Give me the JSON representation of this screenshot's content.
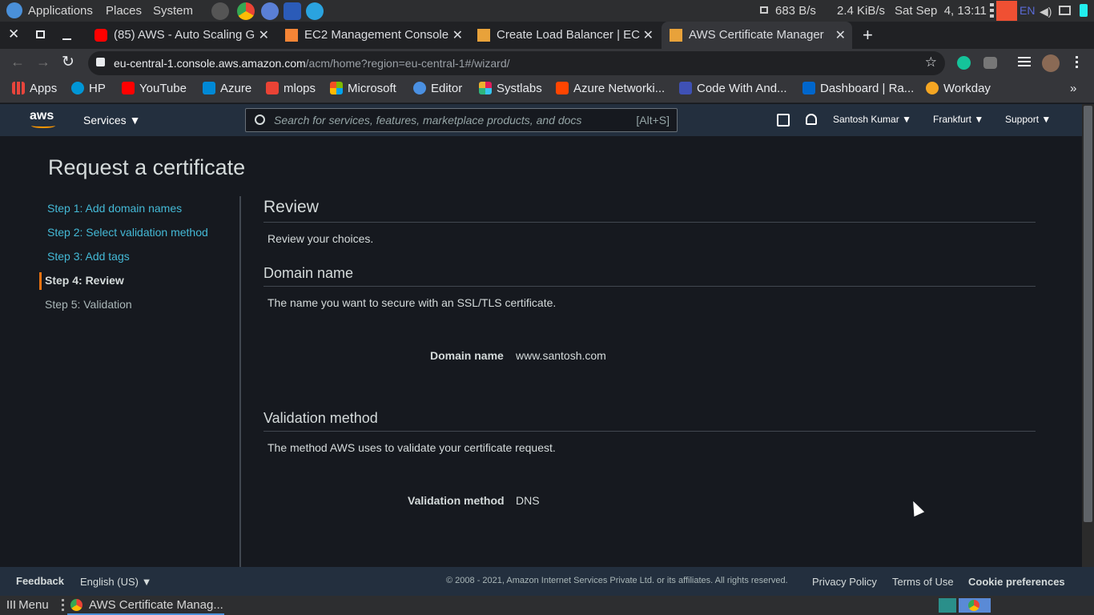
{
  "os": {
    "menu_applications": "Applications",
    "menu_places": "Places",
    "menu_system": "System",
    "net_down": "683 B/s",
    "net_up": "2.4 KiB/s",
    "clock": "Sat Sep  4, 13:11",
    "keyboard": "EN"
  },
  "tabs": [
    {
      "title": "(85) AWS - Auto Scaling G",
      "icon": "youtube-icon"
    },
    {
      "title": "EC2 Management Console",
      "icon": "aws-ec2-icon"
    },
    {
      "title": "Create Load Balancer | EC",
      "icon": "aws-box-icon"
    },
    {
      "title": "AWS Certificate Manager",
      "icon": "aws-box-icon"
    }
  ],
  "address": {
    "host": "eu-central-1.console.aws.amazon.com",
    "path": "/acm/home?region=eu-central-1#/wizard/"
  },
  "bookmarks": [
    {
      "label": "Apps",
      "color": "#e8453c"
    },
    {
      "label": "HP",
      "color": "#0096d6"
    },
    {
      "label": "YouTube",
      "color": "#ff0000"
    },
    {
      "label": "Azure",
      "color": "#0089d6"
    },
    {
      "label": "mlops",
      "color": "#ea4335"
    },
    {
      "label": "Microsoft",
      "color": "#f25022"
    },
    {
      "label": "Editor",
      "color": "#4a90e2"
    },
    {
      "label": "Systlabs",
      "color": "#e01e5a"
    },
    {
      "label": "Azure Networki...",
      "color": "#ff4500"
    },
    {
      "label": "Code With And...",
      "color": "#3f51b5"
    },
    {
      "label": "Dashboard | Ra...",
      "color": "#0066cc"
    },
    {
      "label": "Workday",
      "color": "#f5a623"
    }
  ],
  "aws": {
    "services": "Services",
    "search_placeholder": "Search for services, features, marketplace products, and docs",
    "search_shortcut": "[Alt+S]",
    "user": "Santosh Kumar",
    "region": "Frankfurt",
    "support": "Support"
  },
  "page": {
    "title": "Request a certificate",
    "steps": [
      "Step 1: Add domain names",
      "Step 2: Select validation method",
      "Step 3: Add tags",
      "Step 4: Review",
      "Step 5: Validation"
    ],
    "review_heading": "Review",
    "review_text": "Review your choices.",
    "domain_heading": "Domain name",
    "domain_text": "The name you want to secure with an SSL/TLS certificate.",
    "domain_label": "Domain name",
    "domain_value": "www.santosh.com",
    "validation_heading": "Validation method",
    "validation_text": "The method AWS uses to validate your certificate request.",
    "validation_label": "Validation method",
    "validation_value": "DNS"
  },
  "footer": {
    "feedback": "Feedback",
    "language": "English (US)",
    "copyright": "© 2008 - 2021, Amazon Internet Services Private Ltd. or its affiliates. All rights reserved.",
    "privacy": "Privacy Policy",
    "terms": "Terms of Use",
    "cookie": "Cookie preferences"
  },
  "taskbar": {
    "menu": "Menu",
    "window": "AWS Certificate Manag..."
  }
}
